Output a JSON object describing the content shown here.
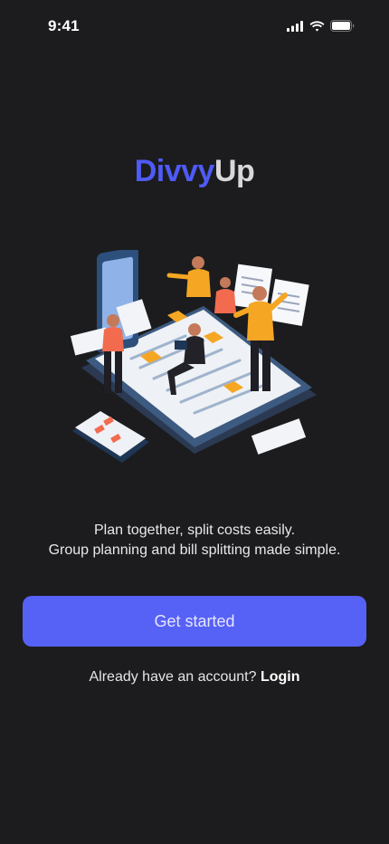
{
  "status_bar": {
    "time": "9:41",
    "icons": [
      "cellular-signal-icon",
      "wifi-icon",
      "battery-icon"
    ]
  },
  "logo": {
    "part_1": "Divvy",
    "part_2": "Up"
  },
  "hero": {
    "icon": "team-planning-illustration"
  },
  "tagline": {
    "line_1": "Plan together, split costs easily.",
    "line_2": "Group planning and bill splitting made simple."
  },
  "primary_button": {
    "label": "Get started"
  },
  "login_prompt": {
    "text": "Already have an account?",
    "link_label": "Login"
  },
  "colors": {
    "background": "#1c1c1e",
    "accent": "#5661f6",
    "logo_accent": "#4f5bf5",
    "illustration_orange": "#f5a623",
    "illustration_coral": "#f26b4f"
  }
}
